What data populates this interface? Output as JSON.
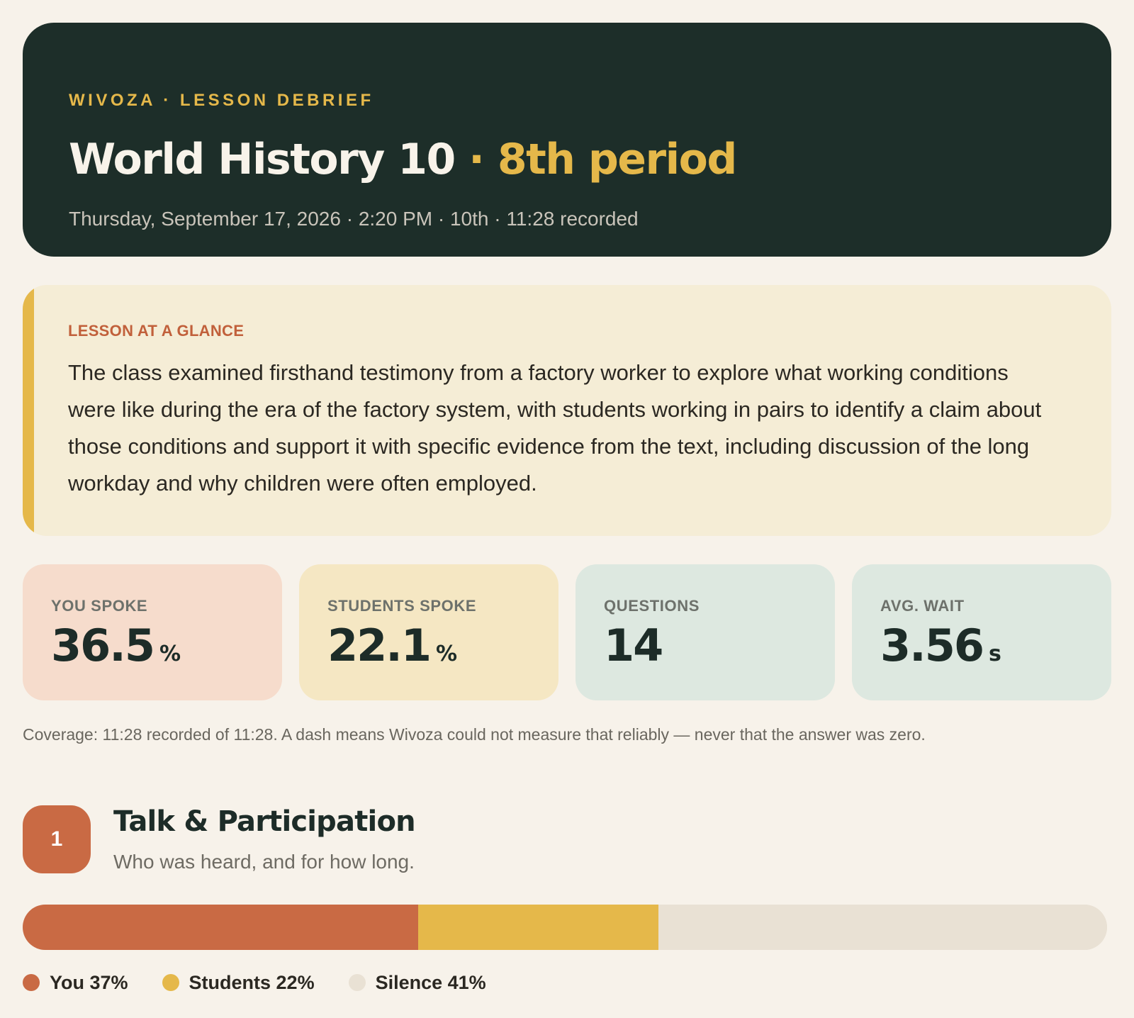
{
  "header": {
    "eyebrow": "WIVOZA · LESSON DEBRIEF",
    "title_main": "World History 10",
    "title_sep": " · ",
    "title_accent": "8th period",
    "meta": "Thursday, September 17, 2026 · 2:20 PM · 10th · 11:28 recorded"
  },
  "glance": {
    "label": "LESSON AT A GLANCE",
    "text": "The class examined firsthand testimony from a factory worker to explore what working conditions were like during the era of the factory system, with students working in pairs to identify a claim about those conditions and support it with specific evidence from the text, including discussion of the long workday and why children were often employed."
  },
  "stats": [
    {
      "label": "YOU SPOKE",
      "value": "36.5",
      "unit": "%"
    },
    {
      "label": "STUDENTS SPOKE",
      "value": "22.1",
      "unit": "%"
    },
    {
      "label": "QUESTIONS",
      "value": "14",
      "unit": ""
    },
    {
      "label": "AVG. WAIT",
      "value": "3.56",
      "unit": "s"
    }
  ],
  "coverage": "Coverage: 11:28 recorded of 11:28. A dash means Wivoza could not measure that reliably — never that the answer was zero.",
  "section": {
    "number": "1",
    "title": "Talk & Participation",
    "subtitle": "Who was heard, and for how long."
  },
  "talk": {
    "segments": [
      {
        "key": "you",
        "label": "You 37%",
        "percent": 36.5,
        "color": "#c96a44"
      },
      {
        "key": "students",
        "label": "Students 22%",
        "percent": 22.1,
        "color": "#e5b84a"
      },
      {
        "key": "silence",
        "label": "Silence 41%",
        "percent": 41.4,
        "color": "#e9e1d4"
      }
    ]
  }
}
